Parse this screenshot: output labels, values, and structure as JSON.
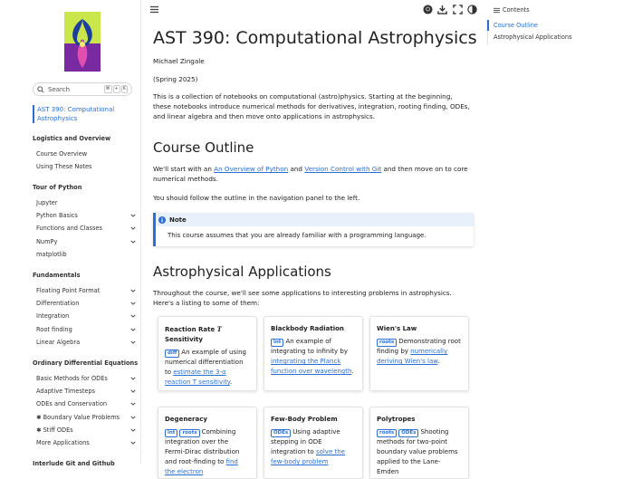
{
  "colors": {
    "accent": "#2a6fd6",
    "text": "#222222",
    "note_bg": "#e8f0fc"
  },
  "sidebar": {
    "search": {
      "placeholder": "Search",
      "shortcut": [
        "⌘",
        "+",
        "K"
      ]
    },
    "site_title": "AST 390: Computational Astrophysics",
    "sections": [
      {
        "caption": "Logistics and Overview",
        "items": [
          {
            "label": "Course Overview",
            "expandable": false
          },
          {
            "label": "Using These Notes",
            "expandable": false
          }
        ]
      },
      {
        "caption": "Tour of Python",
        "items": [
          {
            "label": "Jupyter",
            "expandable": false
          },
          {
            "label": "Python Basics",
            "expandable": true
          },
          {
            "label": "Functions and Classes",
            "expandable": true
          },
          {
            "label": "NumPy",
            "expandable": true
          },
          {
            "label": "matplotlib",
            "expandable": false
          }
        ]
      },
      {
        "caption": "Fundamentals",
        "items": [
          {
            "label": "Floating Point Format",
            "expandable": true
          },
          {
            "label": "Differentiation",
            "expandable": true
          },
          {
            "label": "Integration",
            "expandable": true
          },
          {
            "label": "Root finding",
            "expandable": true
          },
          {
            "label": "Linear Algebra",
            "expandable": true
          }
        ]
      },
      {
        "caption": "Ordinary Differential Equations",
        "items": [
          {
            "label": "Basic Methods for ODEs",
            "expandable": true
          },
          {
            "label": "Adaptive Timesteps",
            "expandable": true
          },
          {
            "label": "ODEs and Conservation",
            "expandable": true
          },
          {
            "label": "✱ Boundary Value Problems",
            "expandable": true
          },
          {
            "label": "✱ Stiff ODEs",
            "expandable": true
          },
          {
            "label": "More Applications",
            "expandable": true
          }
        ]
      },
      {
        "caption": "Interlude Git and Github",
        "items": []
      }
    ]
  },
  "header": {
    "icons": [
      "github-icon",
      "download-icon",
      "fullscreen-icon",
      "theme-toggle-icon"
    ]
  },
  "main": {
    "title": "AST 390: Computational Astrophysics",
    "author": "Michael Zingale",
    "term": "(Spring 2025)",
    "intro": "This is a collection of notebooks on computational (astro)physics. Starting at the beginning, these notebooks introduce numerical methods for derivatives, integration, rooting finding, ODEs, and linear algebra and then move onto applications in astrophysics.",
    "outline_heading": "Course Outline",
    "outline_p1_pre": "We'll start with an ",
    "outline_link1": "An Overview of Python",
    "outline_p1_mid": " and ",
    "outline_link2": "Version Control with Git",
    "outline_p1_post": " and then move on to core numerical methods.",
    "outline_p2": "You should follow the outline in the navigation panel to the left.",
    "note": {
      "title": "Note",
      "body": "This course assumes that you are already familiar with a programming language."
    },
    "apps_heading": "Astrophysical Applications",
    "apps_intro": "Throughout the course, we'll see some applications to interesting problems in astrophysics. Here's a listing to some of them:",
    "cards": [
      {
        "title_pre": "Reaction Rate ",
        "title_math": "T",
        "title_post": " Sensitivity",
        "tags": [
          "diff"
        ],
        "text_pre": "An example of using numerical differentiation to ",
        "link": "estimate the 3-α reaction T sensitivity",
        "text_post": "."
      },
      {
        "title_pre": "Blackbody Radiation",
        "title_math": "",
        "title_post": "",
        "tags": [
          "int"
        ],
        "text_pre": "An example of integrating to infinity by ",
        "link": "integrating the Planck function over wavelength",
        "text_post": "."
      },
      {
        "title_pre": "Wien's Law",
        "title_math": "",
        "title_post": "",
        "tags": [
          "roots"
        ],
        "text_pre": "Demonstrating root finding by ",
        "link": "numerically deriving Wien's law",
        "text_post": "."
      },
      {
        "title_pre": "Degeneracy",
        "title_math": "",
        "title_post": "",
        "tags": [
          "int",
          "roots"
        ],
        "text_pre": "Combining integration over the Fermi-Dirac distribution and root-finding to ",
        "link": "find the electron",
        "text_post": ""
      },
      {
        "title_pre": "Few-Body Problem",
        "title_math": "",
        "title_post": "",
        "tags": [
          "ODEs"
        ],
        "text_pre": "Using adaptive stepping in ODE integration to ",
        "link": "solve the few-body problem",
        "text_post": ""
      },
      {
        "title_pre": "Polytropes",
        "title_math": "",
        "title_post": "",
        "tags": [
          "roots",
          "ODEs"
        ],
        "text_pre": "Shooting methods for two-point boundary value problems applied to the Lane-Emden",
        "link": "",
        "text_post": ""
      }
    ]
  },
  "toc": {
    "heading": "Contents",
    "items": [
      {
        "label": "Course Outline",
        "active": true
      },
      {
        "label": "Astrophysical Applications",
        "active": false
      }
    ]
  }
}
